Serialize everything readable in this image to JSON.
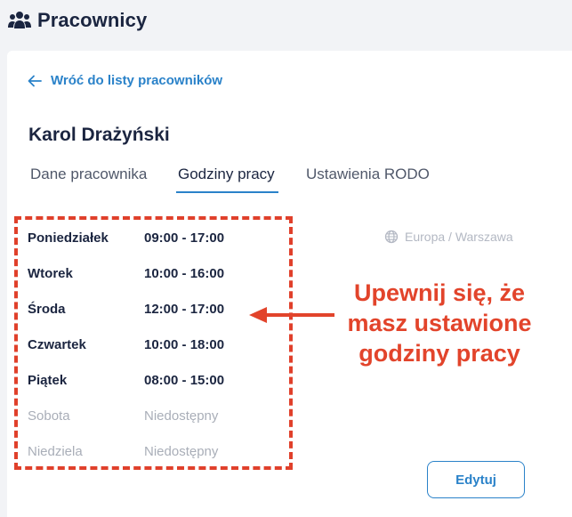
{
  "header": {
    "title": "Pracownicy",
    "icon": "people-icon"
  },
  "back_link": {
    "label": "Wróć do listy pracowników",
    "icon": "arrow-left-icon"
  },
  "employee": {
    "name": "Karol Drażyński"
  },
  "tabs": [
    {
      "label": "Dane pracownika",
      "active": false
    },
    {
      "label": "Godziny pracy",
      "active": true
    },
    {
      "label": "Ustawienia RODO",
      "active": false
    }
  ],
  "timezone": {
    "label": "Europa / Warszawa",
    "icon": "globe-icon"
  },
  "schedule": [
    {
      "day": "Poniedziałek",
      "hours": "09:00 - 17:00",
      "available": true
    },
    {
      "day": "Wtorek",
      "hours": "10:00 - 16:00",
      "available": true
    },
    {
      "day": "Środa",
      "hours": "12:00 - 17:00",
      "available": true
    },
    {
      "day": "Czwartek",
      "hours": "10:00 - 18:00",
      "available": true
    },
    {
      "day": "Piątek",
      "hours": "08:00 - 15:00",
      "available": true
    },
    {
      "day": "Sobota",
      "hours": "Niedostępny",
      "available": false
    },
    {
      "day": "Niedziela",
      "hours": "Niedostępny",
      "available": false
    }
  ],
  "annotation": {
    "line1": "Upewnij się, że",
    "line2": "masz ustawione",
    "line3": "godziny pracy"
  },
  "edit_button": {
    "label": "Edytuj"
  },
  "colors": {
    "accent": "#2a82c9",
    "annotation": "#e2442b",
    "text": "#1b2540",
    "muted": "#a9aeb8"
  }
}
